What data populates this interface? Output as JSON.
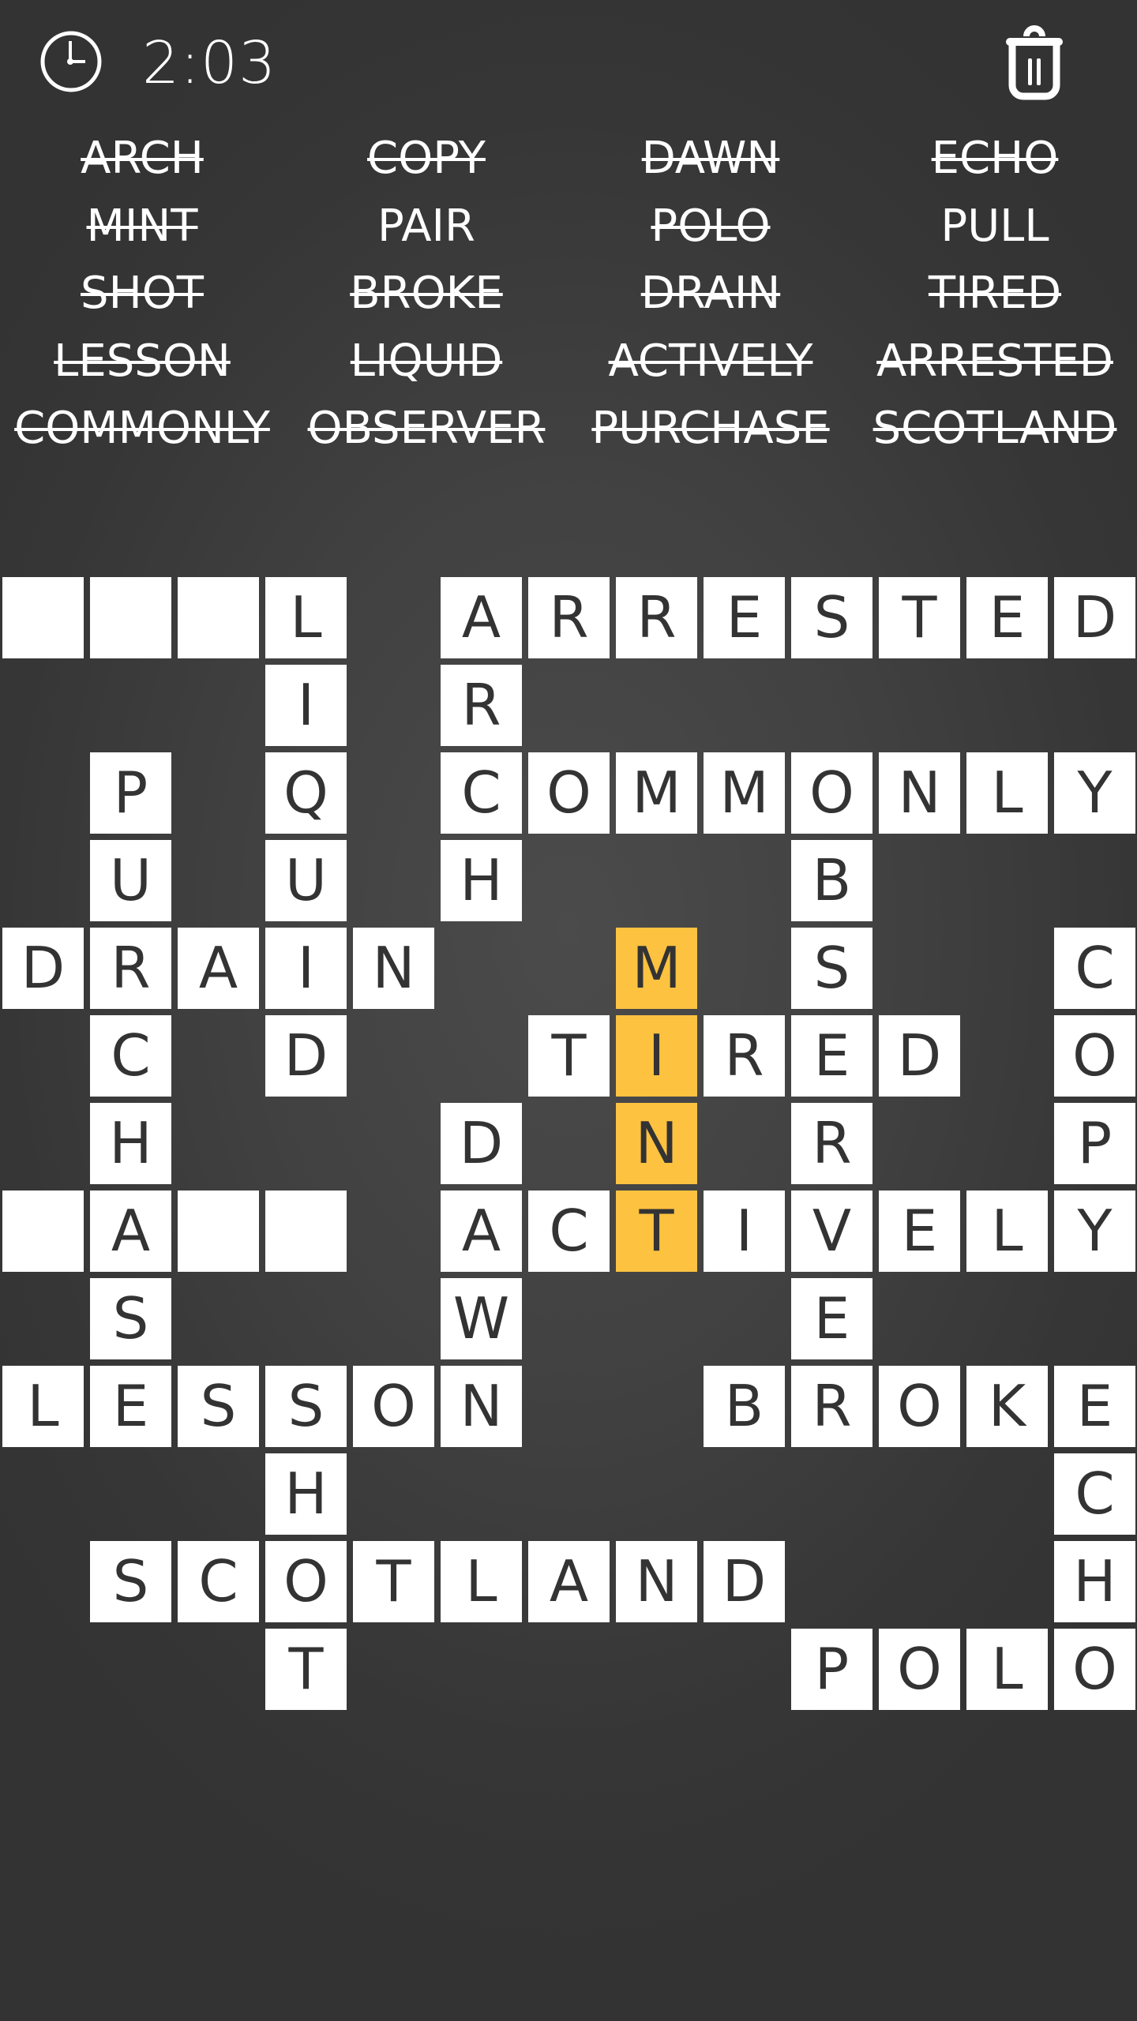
{
  "header": {
    "timer": "2:03",
    "clock_icon": "clock-icon",
    "delete_icon": "trash-icon"
  },
  "word_list": [
    {
      "word": "ARCH",
      "found": true
    },
    {
      "word": "COPY",
      "found": true
    },
    {
      "word": "DAWN",
      "found": true
    },
    {
      "word": "ECHO",
      "found": true
    },
    {
      "word": "MINT",
      "found": true
    },
    {
      "word": "PAIR",
      "found": false
    },
    {
      "word": "POLO",
      "found": true
    },
    {
      "word": "PULL",
      "found": false
    },
    {
      "word": "SHOT",
      "found": true
    },
    {
      "word": "BROKE",
      "found": true
    },
    {
      "word": "DRAIN",
      "found": true
    },
    {
      "word": "TIRED",
      "found": true
    },
    {
      "word": "LESSON",
      "found": true
    },
    {
      "word": "LIQUID",
      "found": true
    },
    {
      "word": "ACTIVELY",
      "found": true
    },
    {
      "word": "ARRESTED",
      "found": true
    },
    {
      "word": "COMMONLY",
      "found": true
    },
    {
      "word": "OBSERVER",
      "found": true
    },
    {
      "word": "PURCHASE",
      "found": true
    },
    {
      "word": "SCOTLAND",
      "found": true
    }
  ],
  "colors": {
    "highlight": "#fcc240",
    "cell": "#ffffff",
    "letter": "#333333"
  },
  "board": {
    "columns": 13,
    "rows": 13,
    "highlighted_word": "MINT",
    "cells": [
      {
        "r": 0,
        "c": 0,
        "l": ""
      },
      {
        "r": 0,
        "c": 1,
        "l": ""
      },
      {
        "r": 0,
        "c": 2,
        "l": ""
      },
      {
        "r": 0,
        "c": 3,
        "l": "L"
      },
      {
        "r": 0,
        "c": 5,
        "l": "A"
      },
      {
        "r": 0,
        "c": 6,
        "l": "R"
      },
      {
        "r": 0,
        "c": 7,
        "l": "R"
      },
      {
        "r": 0,
        "c": 8,
        "l": "E"
      },
      {
        "r": 0,
        "c": 9,
        "l": "S"
      },
      {
        "r": 0,
        "c": 10,
        "l": "T"
      },
      {
        "r": 0,
        "c": 11,
        "l": "E"
      },
      {
        "r": 0,
        "c": 12,
        "l": "D"
      },
      {
        "r": 1,
        "c": 3,
        "l": "I"
      },
      {
        "r": 1,
        "c": 5,
        "l": "R"
      },
      {
        "r": 2,
        "c": 1,
        "l": "P"
      },
      {
        "r": 2,
        "c": 3,
        "l": "Q"
      },
      {
        "r": 2,
        "c": 5,
        "l": "C"
      },
      {
        "r": 2,
        "c": 6,
        "l": "O"
      },
      {
        "r": 2,
        "c": 7,
        "l": "M"
      },
      {
        "r": 2,
        "c": 8,
        "l": "M"
      },
      {
        "r": 2,
        "c": 9,
        "l": "O"
      },
      {
        "r": 2,
        "c": 10,
        "l": "N"
      },
      {
        "r": 2,
        "c": 11,
        "l": "L"
      },
      {
        "r": 2,
        "c": 12,
        "l": "Y"
      },
      {
        "r": 3,
        "c": 1,
        "l": "U"
      },
      {
        "r": 3,
        "c": 3,
        "l": "U"
      },
      {
        "r": 3,
        "c": 5,
        "l": "H"
      },
      {
        "r": 3,
        "c": 9,
        "l": "B"
      },
      {
        "r": 4,
        "c": 0,
        "l": "D"
      },
      {
        "r": 4,
        "c": 1,
        "l": "R"
      },
      {
        "r": 4,
        "c": 2,
        "l": "A"
      },
      {
        "r": 4,
        "c": 3,
        "l": "I"
      },
      {
        "r": 4,
        "c": 4,
        "l": "N"
      },
      {
        "r": 4,
        "c": 7,
        "l": "M",
        "hl": true
      },
      {
        "r": 4,
        "c": 9,
        "l": "S"
      },
      {
        "r": 4,
        "c": 12,
        "l": "C"
      },
      {
        "r": 5,
        "c": 1,
        "l": "C"
      },
      {
        "r": 5,
        "c": 3,
        "l": "D"
      },
      {
        "r": 5,
        "c": 6,
        "l": "T"
      },
      {
        "r": 5,
        "c": 7,
        "l": "I",
        "hl": true
      },
      {
        "r": 5,
        "c": 8,
        "l": "R"
      },
      {
        "r": 5,
        "c": 9,
        "l": "E"
      },
      {
        "r": 5,
        "c": 10,
        "l": "D"
      },
      {
        "r": 5,
        "c": 12,
        "l": "O"
      },
      {
        "r": 6,
        "c": 1,
        "l": "H"
      },
      {
        "r": 6,
        "c": 5,
        "l": "D"
      },
      {
        "r": 6,
        "c": 7,
        "l": "N",
        "hl": true
      },
      {
        "r": 6,
        "c": 9,
        "l": "R"
      },
      {
        "r": 6,
        "c": 12,
        "l": "P"
      },
      {
        "r": 7,
        "c": 0,
        "l": ""
      },
      {
        "r": 7,
        "c": 1,
        "l": "A"
      },
      {
        "r": 7,
        "c": 2,
        "l": ""
      },
      {
        "r": 7,
        "c": 3,
        "l": ""
      },
      {
        "r": 7,
        "c": 5,
        "l": "A"
      },
      {
        "r": 7,
        "c": 6,
        "l": "C"
      },
      {
        "r": 7,
        "c": 7,
        "l": "T",
        "hl": true
      },
      {
        "r": 7,
        "c": 8,
        "l": "I"
      },
      {
        "r": 7,
        "c": 9,
        "l": "V"
      },
      {
        "r": 7,
        "c": 10,
        "l": "E"
      },
      {
        "r": 7,
        "c": 11,
        "l": "L"
      },
      {
        "r": 7,
        "c": 12,
        "l": "Y"
      },
      {
        "r": 8,
        "c": 1,
        "l": "S"
      },
      {
        "r": 8,
        "c": 5,
        "l": "W"
      },
      {
        "r": 8,
        "c": 9,
        "l": "E"
      },
      {
        "r": 9,
        "c": 0,
        "l": "L"
      },
      {
        "r": 9,
        "c": 1,
        "l": "E"
      },
      {
        "r": 9,
        "c": 2,
        "l": "S"
      },
      {
        "r": 9,
        "c": 3,
        "l": "S"
      },
      {
        "r": 9,
        "c": 4,
        "l": "O"
      },
      {
        "r": 9,
        "c": 5,
        "l": "N"
      },
      {
        "r": 9,
        "c": 8,
        "l": "B"
      },
      {
        "r": 9,
        "c": 9,
        "l": "R"
      },
      {
        "r": 9,
        "c": 10,
        "l": "O"
      },
      {
        "r": 9,
        "c": 11,
        "l": "K"
      },
      {
        "r": 9,
        "c": 12,
        "l": "E"
      },
      {
        "r": 10,
        "c": 3,
        "l": "H"
      },
      {
        "r": 10,
        "c": 12,
        "l": "C"
      },
      {
        "r": 11,
        "c": 1,
        "l": "S"
      },
      {
        "r": 11,
        "c": 2,
        "l": "C"
      },
      {
        "r": 11,
        "c": 3,
        "l": "O"
      },
      {
        "r": 11,
        "c": 4,
        "l": "T"
      },
      {
        "r": 11,
        "c": 5,
        "l": "L"
      },
      {
        "r": 11,
        "c": 6,
        "l": "A"
      },
      {
        "r": 11,
        "c": 7,
        "l": "N"
      },
      {
        "r": 11,
        "c": 8,
        "l": "D"
      },
      {
        "r": 11,
        "c": 12,
        "l": "H"
      },
      {
        "r": 12,
        "c": 3,
        "l": "T"
      },
      {
        "r": 12,
        "c": 9,
        "l": "P"
      },
      {
        "r": 12,
        "c": 10,
        "l": "O"
      },
      {
        "r": 12,
        "c": 11,
        "l": "L"
      },
      {
        "r": 12,
        "c": 12,
        "l": "O"
      }
    ]
  }
}
